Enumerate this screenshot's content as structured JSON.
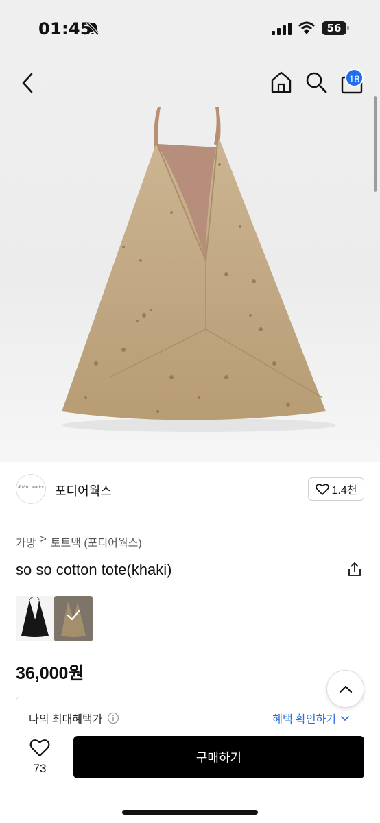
{
  "status": {
    "time": "01:45",
    "battery": "56"
  },
  "nav": {
    "cart_count": "18"
  },
  "shop": {
    "avatar_text": "4dian works",
    "name": "포디어웍스",
    "likes": "1.4천"
  },
  "breadcrumb": {
    "items": [
      "가방",
      "토트백 (포디어웍스)"
    ],
    "separator": ">"
  },
  "product": {
    "title": "so so cotton tote(khaki)",
    "price": "36,000원",
    "thumbnails": [
      "black",
      "khaki"
    ]
  },
  "benefit": {
    "label": "나의 최대혜택가",
    "link": "혜택 확인하기"
  },
  "bottom": {
    "wish_count": "73",
    "buy_label": "구매하기"
  },
  "colors": {
    "accent_blue": "#2a6fdb",
    "badge_blue": "#1f6ef0",
    "buy_button": "#000000",
    "bag_khaki": "#c2a882"
  }
}
